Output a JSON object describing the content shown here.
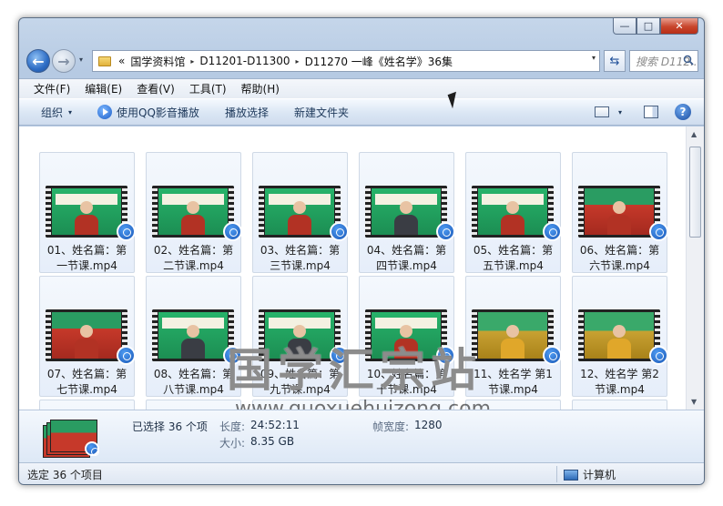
{
  "window": {
    "controls": {
      "minimize": "—",
      "maximize": "□",
      "close": "✕"
    }
  },
  "address": {
    "overflow": "«",
    "crumbs": [
      "国学资料馆",
      "D11201-D11300",
      "D11270 一峰《姓名学》36集"
    ],
    "separator": "▸",
    "dropdown": "▾"
  },
  "search": {
    "placeholder": "搜索 D112..."
  },
  "menu": [
    "文件(F)",
    "编辑(E)",
    "查看(V)",
    "工具(T)",
    "帮助(H)"
  ],
  "toolbar": {
    "organize": "组织",
    "play_qq": "使用QQ影音播放",
    "play_selection": "播放选择",
    "new_folder": "新建文件夹",
    "caret": "▾",
    "help": "?"
  },
  "files": [
    {
      "line1": "01、姓名篇：第",
      "line2": "一节课.mp4",
      "style": "green"
    },
    {
      "line1": "02、姓名篇：第",
      "line2": "二节课.mp4",
      "style": "green"
    },
    {
      "line1": "03、姓名篇：第",
      "line2": "三节课.mp4",
      "style": "green"
    },
    {
      "line1": "04、姓名篇：第",
      "line2": "四节课.mp4",
      "style": "green-dark"
    },
    {
      "line1": "05、姓名篇：第",
      "line2": "五节课.mp4",
      "style": "green"
    },
    {
      "line1": "06、姓名篇：第",
      "line2": "六节课.mp4",
      "style": "red"
    },
    {
      "line1": "07、姓名篇：第",
      "line2": "七节课.mp4",
      "style": "red"
    },
    {
      "line1": "08、姓名篇：第",
      "line2": "八节课.mp4",
      "style": "green-dark"
    },
    {
      "line1": "09、姓名篇：第",
      "line2": "九节课.mp4",
      "style": "green-dark"
    },
    {
      "line1": "10、姓名篇：第",
      "line2": "十节课.mp4",
      "style": "green"
    },
    {
      "line1": "11、姓名学 第1",
      "line2": "节课.mp4",
      "style": "gold"
    },
    {
      "line1": "12、姓名学 第2",
      "line2": "节课.mp4",
      "style": "gold"
    }
  ],
  "watermark": {
    "cn": "国学汇宗站",
    "url": "www.guoxuehuizong.com"
  },
  "details": {
    "selected": "已选择 36 个项",
    "length_label": "长度:",
    "length_value": "24:52:11",
    "size_label": "大小:",
    "size_value": "8.35 GB",
    "width_label": "帧宽度:",
    "width_value": "1280"
  },
  "status": {
    "left": "选定 36 个项目",
    "right": "计算机"
  },
  "scroll": {
    "up": "▲",
    "down": "▼"
  }
}
